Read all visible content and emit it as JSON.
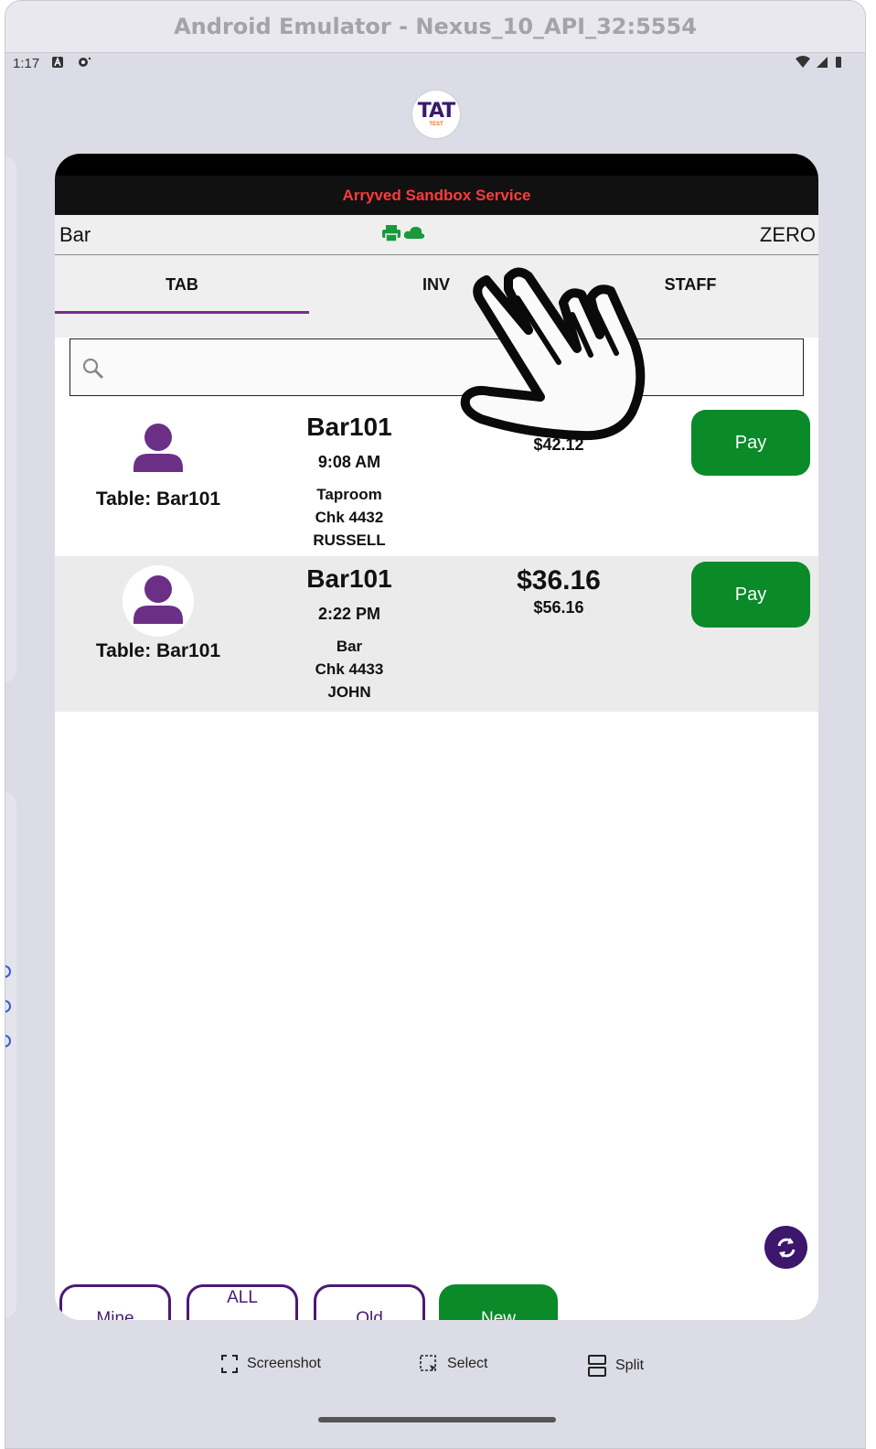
{
  "emulator": {
    "title": "Android Emulator - Nexus_10_API_32:5554",
    "toolbar": [
      {
        "label": "Screenshot",
        "icon": "screenshot-icon"
      },
      {
        "label": "Select",
        "icon": "select-icon"
      },
      {
        "label": "Split",
        "icon": "split-icon"
      }
    ]
  },
  "status_bar": {
    "time": "1:17",
    "icons": [
      "notification-a-icon",
      "sync-icon",
      "wifi-icon",
      "signal-icon",
      "battery-icon"
    ]
  },
  "logo": {
    "main": "TAT",
    "sub": "TEST"
  },
  "app": {
    "service_title": "Arryved Sandbox Service",
    "location": "Bar",
    "mode": "ZERO",
    "status_icons": [
      "printer-icon",
      "cloud-icon"
    ],
    "tabs": [
      {
        "label": "TAB",
        "active": true
      },
      {
        "label": "INV",
        "active": false
      },
      {
        "label": "STAFF",
        "active": false
      }
    ],
    "search": {
      "placeholder": "",
      "value": ""
    },
    "rows": [
      {
        "table": "Table: Bar101",
        "name": "Bar101",
        "time": "9:08 AM",
        "location": "Taproom",
        "check": "Chk 4432",
        "server": "RUSSELL",
        "amount": "",
        "total": "$42.12",
        "pay_label": "Pay"
      },
      {
        "table": "Table: Bar101",
        "name": "Bar101",
        "time": "2:22 PM",
        "location": "Bar",
        "check": "Chk 4433",
        "server": "JOHN",
        "amount": "$36.16",
        "total": "$56.16",
        "pay_label": "Pay"
      }
    ],
    "filters": [
      {
        "label": "Mine"
      },
      {
        "label": "ALL"
      },
      {
        "label": "Old"
      },
      {
        "label": "New"
      }
    ],
    "colors": {
      "accent": "#3d176b",
      "pay_green": "#0a8a28",
      "service_red": "#ff3b3b",
      "avatar_purple": "#6b2f86"
    }
  }
}
